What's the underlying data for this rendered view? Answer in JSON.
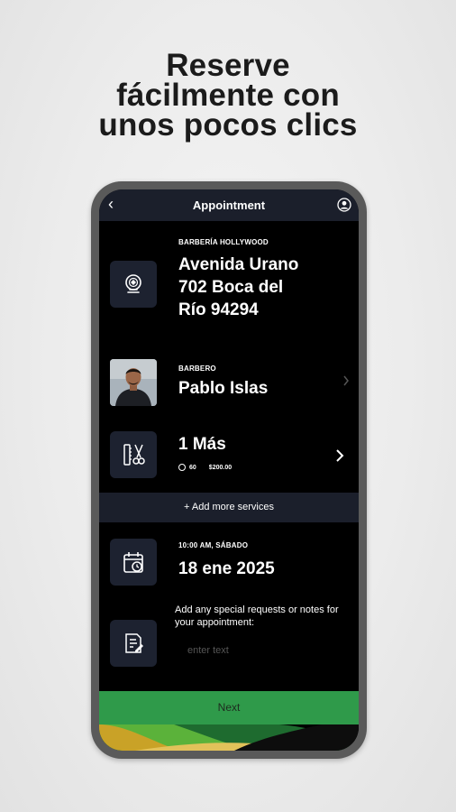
{
  "headline": [
    "Reserve",
    "fácilmente con",
    "unos pocos clics"
  ],
  "header": {
    "title": "Appointment"
  },
  "shop": {
    "label": "BARBERÍA HOLLYWOOD",
    "address": [
      "Avenida Urano",
      "702 Boca del",
      "Río 94294"
    ]
  },
  "barber": {
    "label": "BARBERO",
    "name": "Pablo Islas"
  },
  "services": {
    "title": "1 Más",
    "duration": "60",
    "price": "$200.00"
  },
  "add_services": "+ Add more services",
  "datetime": {
    "time_day": "10:00 AM,  SÁBADO",
    "date": "18 ene 2025"
  },
  "notes": {
    "label": "Add any special requests or notes for your appointment:",
    "placeholder": "enter text"
  },
  "next_label": "Next",
  "colors": {
    "header_bg": "#1b1f2b",
    "icon_box_bg": "#1d2230",
    "next_green": "#2f9a4a",
    "frame": "#5a5a5a"
  },
  "icons": [
    "back-arrow-icon",
    "user-profile-icon",
    "barber-pole-icon",
    "scissors-comb-icon",
    "calendar-icon",
    "notes-icon",
    "chevron-right-icon",
    "clock-icon"
  ]
}
